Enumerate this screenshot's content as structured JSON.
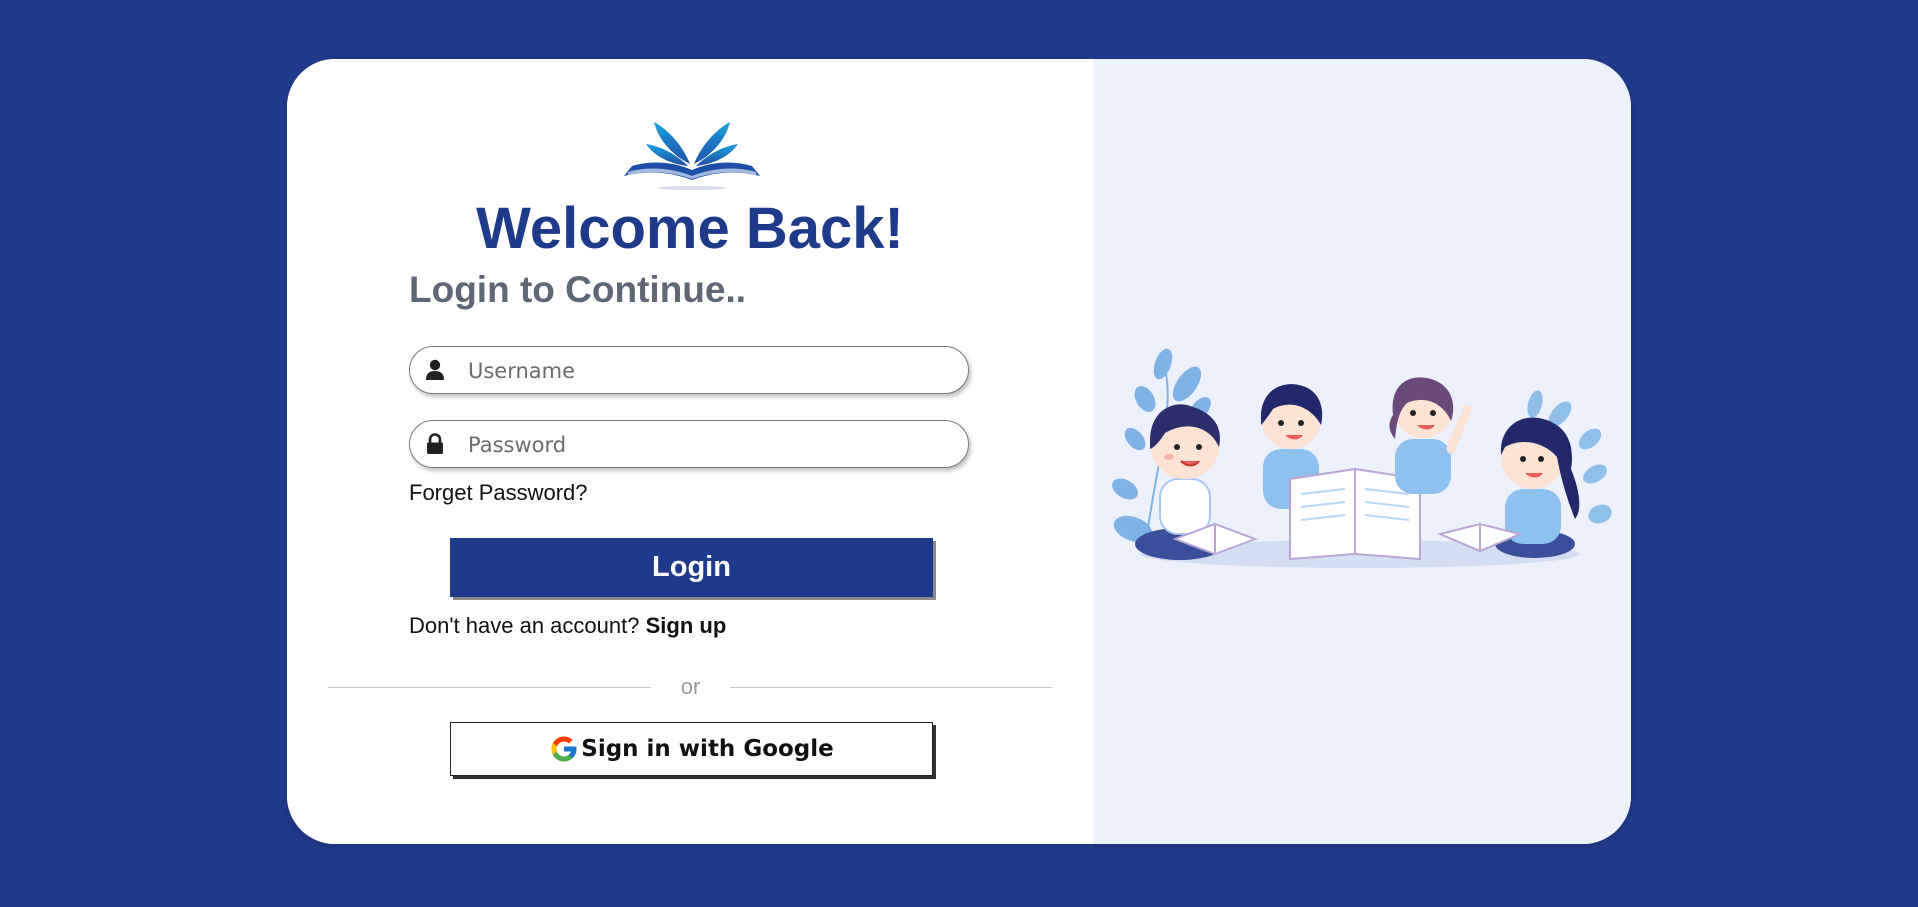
{
  "header": {
    "title": "Welcome Back!",
    "subtitle": "Login to Continue..",
    "logo_icon": "open-book-logo"
  },
  "form": {
    "username_placeholder": "Username",
    "password_placeholder": "Password",
    "username_icon": "user-icon",
    "password_icon": "lock-icon",
    "forgot_label": "Forget Password?",
    "login_label": "Login",
    "signup_prompt": "Don't have an account?",
    "signup_link": "Sign up",
    "divider_text": "or",
    "google_label": "Sign in with Google",
    "google_icon": "google-g-icon"
  },
  "illustration": {
    "icon": "children-reading-illustration"
  },
  "colors": {
    "background": "#1f3a8a",
    "primary": "#1e3a8a",
    "subtitle": "#5f6775",
    "right_panel": "#edf1fc"
  }
}
